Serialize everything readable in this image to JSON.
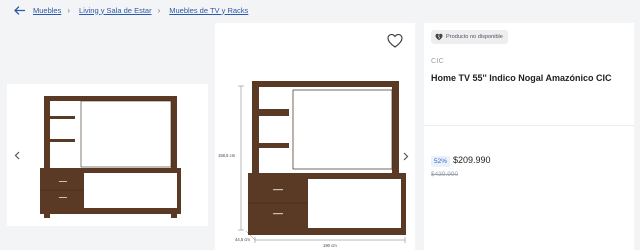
{
  "breadcrumb": {
    "items": [
      "Muebles",
      "Living y Sala de Estar",
      "Muebles de TV y Racks"
    ],
    "separator": "›"
  },
  "gallery": {
    "dimensions": {
      "height": "158,5 cm",
      "depth": "44,5 cm",
      "width": "190 cm"
    }
  },
  "product": {
    "availability_badge": "Producto no disponible",
    "brand": "CIC",
    "title": "Home TV 55'' Indico Nogal Amazónico CIC",
    "discount": "52%",
    "price": "$209.990",
    "old_price": "$439.990"
  },
  "colors": {
    "link": "#2b5aa8",
    "discount_bg": "#eaf1fb",
    "discount_text": "#3768c4",
    "wood": "#5a3a24"
  },
  "icons": {
    "back": "arrow-left-icon",
    "favorite": "heart-icon",
    "badge": "broken-heart-icon",
    "prev": "chevron-left-icon",
    "next": "chevron-right-icon"
  }
}
